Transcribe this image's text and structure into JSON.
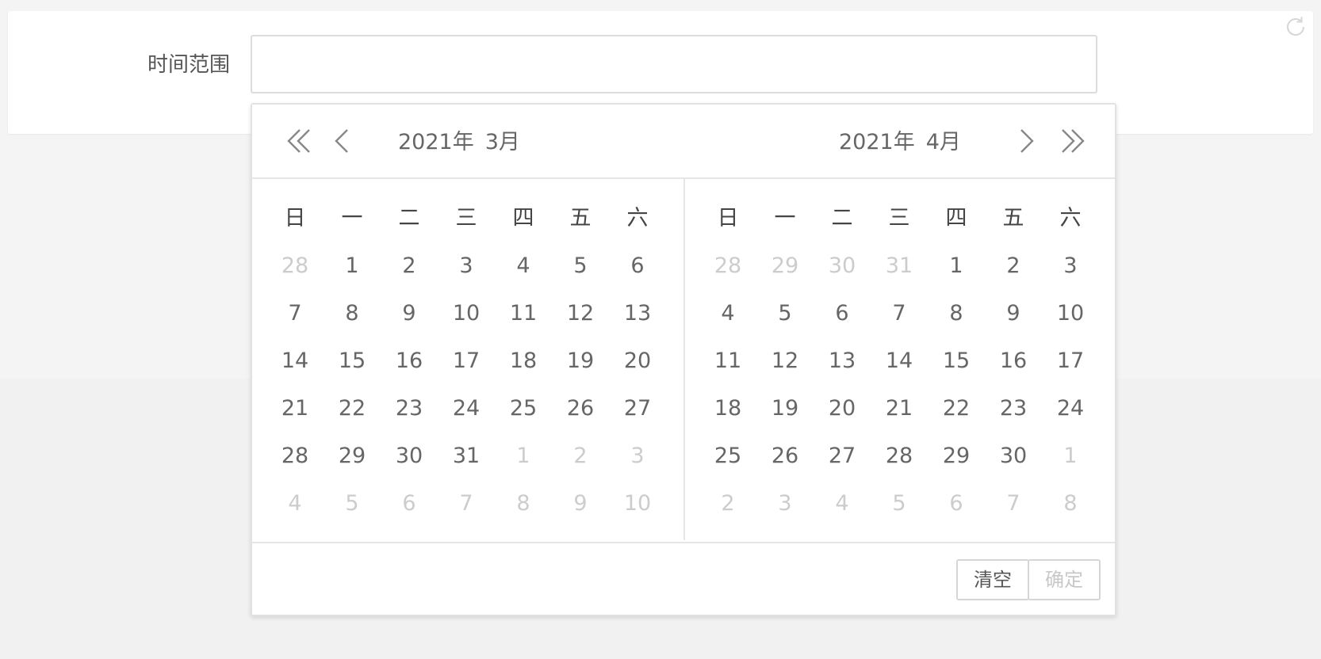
{
  "form": {
    "label": "时间范围",
    "value": "",
    "placeholder": ""
  },
  "icons": {
    "top_right": "refresh-icon",
    "prev_year": "double-chevron-left-icon",
    "prev_month": "chevron-left-icon",
    "next_month": "chevron-right-icon",
    "next_year": "double-chevron-right-icon"
  },
  "picker": {
    "weekdays": [
      "日",
      "一",
      "二",
      "三",
      "四",
      "五",
      "六"
    ],
    "left": {
      "year": "2021年",
      "month": "3月",
      "days": [
        {
          "d": "28",
          "other": true
        },
        {
          "d": "1"
        },
        {
          "d": "2"
        },
        {
          "d": "3"
        },
        {
          "d": "4"
        },
        {
          "d": "5"
        },
        {
          "d": "6"
        },
        {
          "d": "7"
        },
        {
          "d": "8"
        },
        {
          "d": "9"
        },
        {
          "d": "10"
        },
        {
          "d": "11"
        },
        {
          "d": "12"
        },
        {
          "d": "13"
        },
        {
          "d": "14"
        },
        {
          "d": "15"
        },
        {
          "d": "16"
        },
        {
          "d": "17"
        },
        {
          "d": "18"
        },
        {
          "d": "19"
        },
        {
          "d": "20"
        },
        {
          "d": "21"
        },
        {
          "d": "22"
        },
        {
          "d": "23"
        },
        {
          "d": "24"
        },
        {
          "d": "25"
        },
        {
          "d": "26"
        },
        {
          "d": "27"
        },
        {
          "d": "28"
        },
        {
          "d": "29"
        },
        {
          "d": "30"
        },
        {
          "d": "31"
        },
        {
          "d": "1",
          "other": true
        },
        {
          "d": "2",
          "other": true
        },
        {
          "d": "3",
          "other": true
        },
        {
          "d": "4",
          "other": true
        },
        {
          "d": "5",
          "other": true
        },
        {
          "d": "6",
          "other": true
        },
        {
          "d": "7",
          "other": true
        },
        {
          "d": "8",
          "other": true
        },
        {
          "d": "9",
          "other": true
        },
        {
          "d": "10",
          "other": true
        }
      ]
    },
    "right": {
      "year": "2021年",
      "month": "4月",
      "days": [
        {
          "d": "28",
          "other": true
        },
        {
          "d": "29",
          "other": true
        },
        {
          "d": "30",
          "other": true
        },
        {
          "d": "31",
          "other": true
        },
        {
          "d": "1"
        },
        {
          "d": "2"
        },
        {
          "d": "3"
        },
        {
          "d": "4"
        },
        {
          "d": "5"
        },
        {
          "d": "6"
        },
        {
          "d": "7"
        },
        {
          "d": "8"
        },
        {
          "d": "9"
        },
        {
          "d": "10"
        },
        {
          "d": "11"
        },
        {
          "d": "12"
        },
        {
          "d": "13"
        },
        {
          "d": "14"
        },
        {
          "d": "15"
        },
        {
          "d": "16"
        },
        {
          "d": "17"
        },
        {
          "d": "18"
        },
        {
          "d": "19"
        },
        {
          "d": "20"
        },
        {
          "d": "21"
        },
        {
          "d": "22"
        },
        {
          "d": "23"
        },
        {
          "d": "24"
        },
        {
          "d": "25"
        },
        {
          "d": "26"
        },
        {
          "d": "27"
        },
        {
          "d": "28"
        },
        {
          "d": "29"
        },
        {
          "d": "30"
        },
        {
          "d": "1",
          "other": true
        },
        {
          "d": "2",
          "other": true
        },
        {
          "d": "3",
          "other": true
        },
        {
          "d": "4",
          "other": true
        },
        {
          "d": "5",
          "other": true
        },
        {
          "d": "6",
          "other": true
        },
        {
          "d": "7",
          "other": true
        },
        {
          "d": "8",
          "other": true
        }
      ]
    },
    "footer": {
      "clear_label": "清空",
      "confirm_label": "确定"
    }
  },
  "colors": {
    "text": "#666666",
    "muted": "#cccccc",
    "border": "#dcdcdc",
    "background": "#f4f4f4"
  }
}
